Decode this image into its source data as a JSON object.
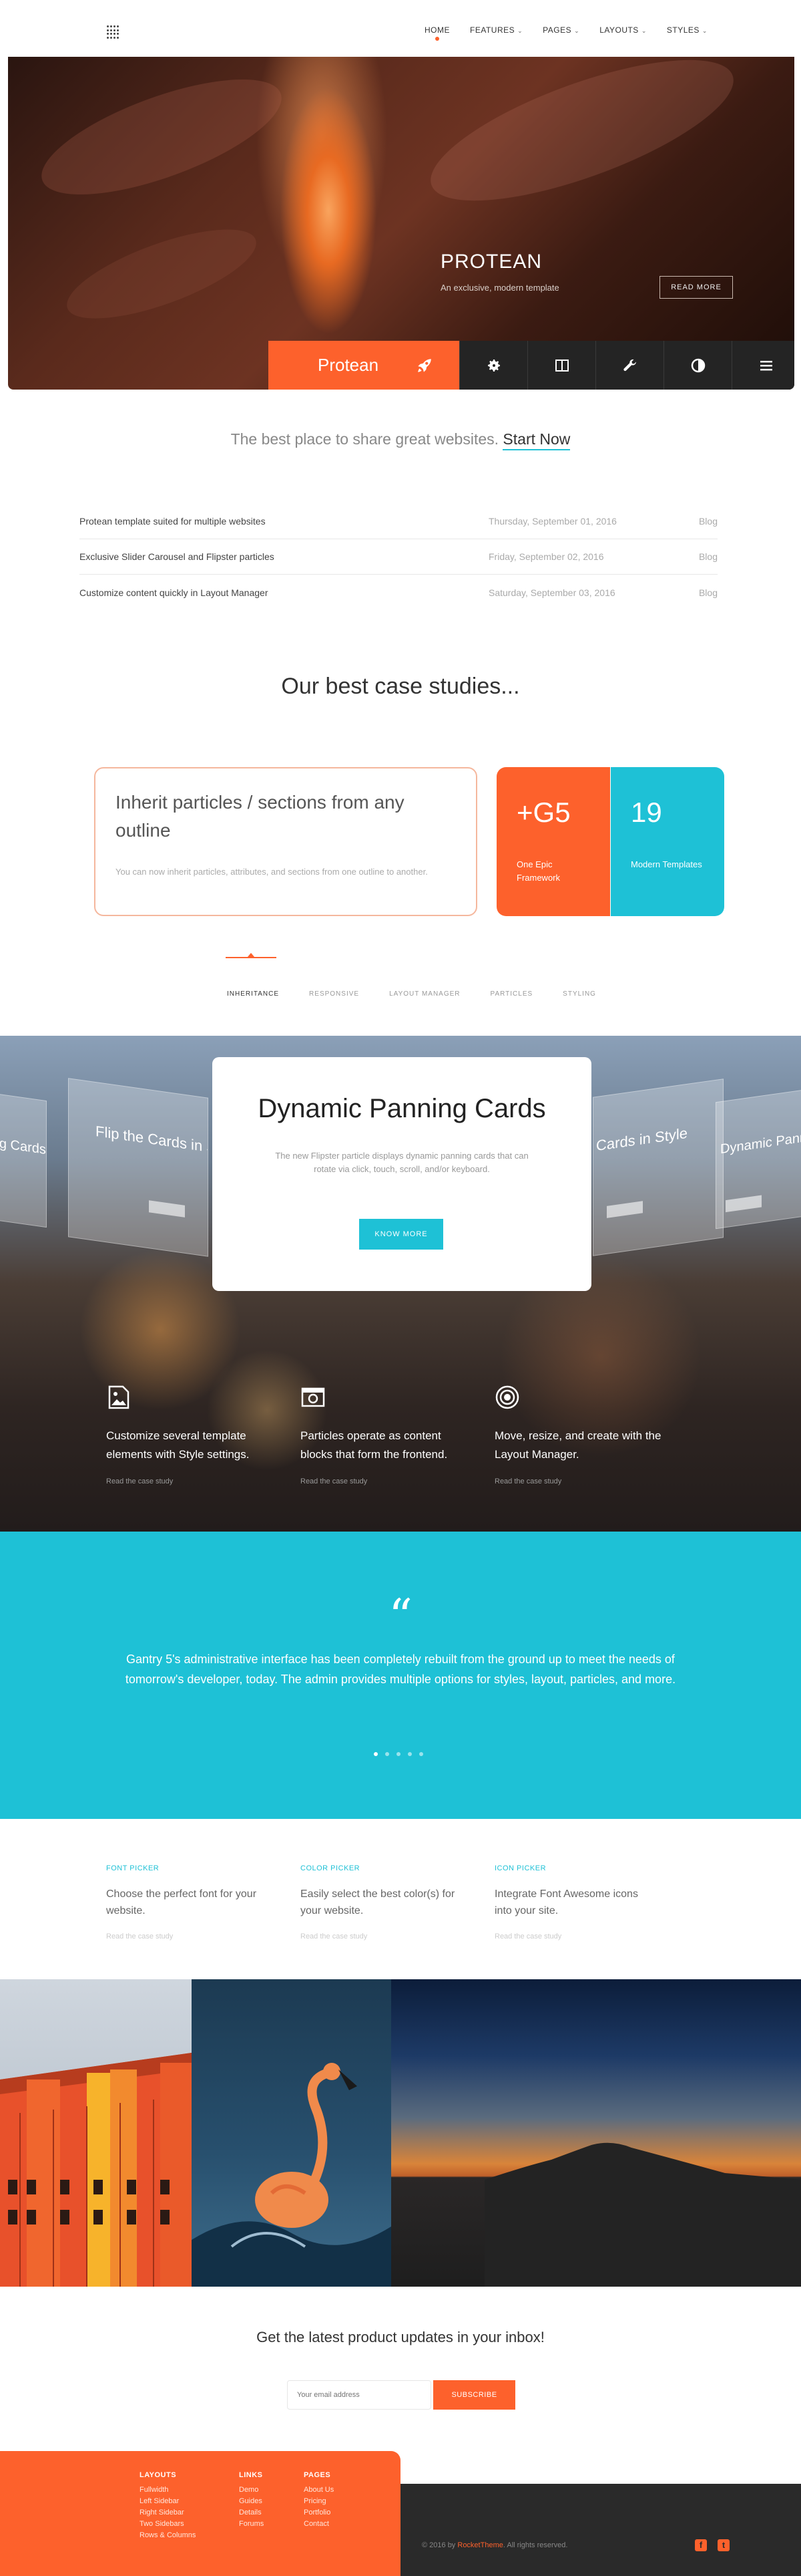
{
  "nav": {
    "items": [
      {
        "label": "HOME",
        "active": true,
        "dropdown": false
      },
      {
        "label": "FEATURES",
        "active": false,
        "dropdown": true
      },
      {
        "label": "PAGES",
        "active": false,
        "dropdown": true
      },
      {
        "label": "LAYOUTS",
        "active": false,
        "dropdown": true
      },
      {
        "label": "STYLES",
        "active": false,
        "dropdown": true
      }
    ]
  },
  "hero": {
    "title": "PROTEAN",
    "subtitle": "An exclusive, modern template",
    "button": "READ MORE",
    "toolbar_brand": "Protean",
    "toolbar_icons": [
      "rocket-icon",
      "gear-icon",
      "columns-icon",
      "wrench-icon",
      "contrast-icon",
      "menu-icon"
    ]
  },
  "tagline": {
    "text": "The best place to share great websites.",
    "link": "Start Now"
  },
  "posts": [
    {
      "title": "Protean template suited for multiple websites",
      "date": "Thursday, September 01, 2016",
      "category": "Blog"
    },
    {
      "title": "Exclusive Slider Carousel and Flipster particles",
      "date": "Friday, September 02, 2016",
      "category": "Blog"
    },
    {
      "title": "Customize content quickly in Layout Manager",
      "date": "Saturday, September 03, 2016",
      "category": "Blog"
    }
  ],
  "case_studies": {
    "title": "Our best case studies...",
    "card_heading": "Inherit particles / sections from any outline",
    "card_text": "You can now inherit particles, attributes, and sections from one outline to another.",
    "tiles": [
      {
        "big": "+G5",
        "small": "One Epic Framework",
        "color": "#fd612c"
      },
      {
        "big": "19",
        "small": "Modern Templates",
        "color": "#1ec1d6"
      }
    ],
    "tabs": [
      "INHERITANCE",
      "RESPONSIVE",
      "LAYOUT MANAGER",
      "PARTICLES",
      "STYLING"
    ],
    "active_tab": "INHERITANCE"
  },
  "dynamic": {
    "side_card_left_far": "c Panning Cards",
    "side_card_left": "Flip the Cards in Style",
    "side_card_right": "Cards in Style",
    "side_card_right_far": "Dynamic Pannin",
    "title": "Dynamic Panning Cards",
    "text": "The new Flipster particle displays dynamic panning cards that can rotate via click, touch, scroll, and/or keyboard.",
    "button": "KNOW MORE",
    "features": [
      {
        "icon": "image-icon",
        "text": "Customize several template elements with Style settings.",
        "link": "Read the case study"
      },
      {
        "icon": "camera-icon",
        "text": "Particles operate as content blocks that form the frontend.",
        "link": "Read the case study"
      },
      {
        "icon": "target-icon",
        "text": "Move, resize, and create with the Layout Manager.",
        "link": "Read the case study"
      }
    ]
  },
  "testimonial": {
    "quote_mark": "“",
    "text": "Gantry 5's administrative interface has been completely rebuilt from the ground up to meet the needs of tomorrow's developer, today. The admin provides multiple options for styles, layout, particles, and more.",
    "dots": 5,
    "active_dot": 0
  },
  "pickers": [
    {
      "heading": "FONT PICKER",
      "text": "Choose the perfect font for your website.",
      "link": "Read the case study"
    },
    {
      "heading": "COLOR PICKER",
      "text": "Easily select the best color(s) for your website.",
      "link": "Read the case study"
    },
    {
      "heading": "ICON PICKER",
      "text": "Integrate Font Awesome icons into your site.",
      "link": "Read the case study"
    }
  ],
  "newsletter": {
    "title": "Get the latest product updates in your inbox!",
    "placeholder": "Your email address",
    "button": "SUBSCRIBE"
  },
  "footer": {
    "columns": [
      {
        "heading": "LAYOUTS",
        "links": [
          "Fullwidth",
          "Left Sidebar",
          "Right Sidebar",
          "Two Sidebars",
          "Rows & Columns"
        ]
      },
      {
        "heading": "LINKS",
        "links": [
          "Demo",
          "Guides",
          "Details",
          "Forums"
        ]
      },
      {
        "heading": "PAGES",
        "links": [
          "About Us",
          "Pricing",
          "Portfolio",
          "Contact"
        ]
      }
    ],
    "copyright_prefix": "© 2016 by",
    "copyright_brand": "RocketTheme",
    "copyright_suffix": ". All rights reserved.",
    "social": [
      "facebook-icon",
      "twitter-icon"
    ]
  },
  "colors": {
    "accent": "#fd612c",
    "secondary": "#1ec1d6",
    "dark": "#2a2a2a"
  }
}
